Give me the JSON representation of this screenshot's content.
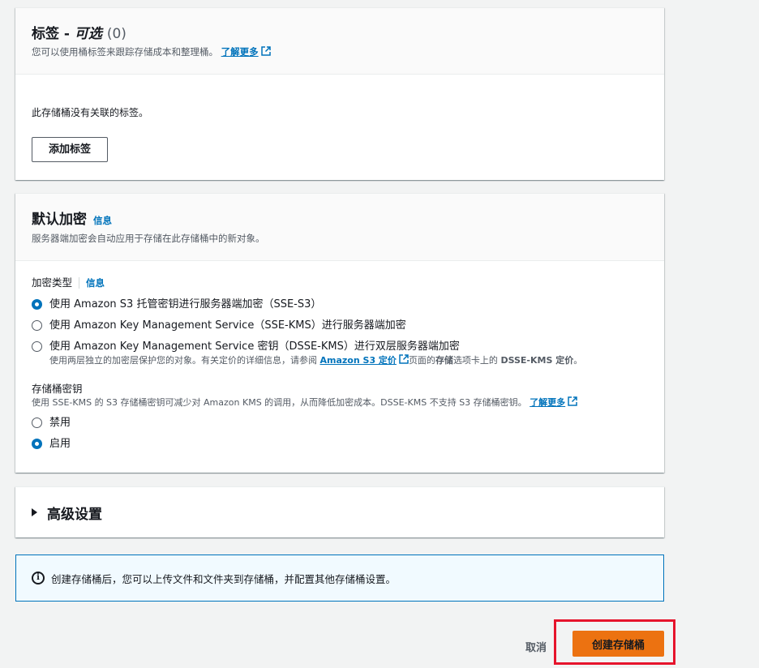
{
  "tags": {
    "title": "标签 - ",
    "title_italic": "可选",
    "count": "(0)",
    "desc": "您可以使用桶标签来跟踪存储成本和整理桶。",
    "learn_more": "了解更多",
    "empty_text": "此存储桶没有关联的标签。",
    "add_button": "添加标签"
  },
  "encryption": {
    "title": "默认加密",
    "info": "信息",
    "desc": "服务器端加密会自动应用于存储在此存储桶中的新对象。",
    "type_label": "加密类型",
    "type_info": "信息",
    "options": [
      {
        "label": "使用 Amazon S3 托管密钥进行服务器端加密（SSE-S3）",
        "selected": true
      },
      {
        "label": "使用 Amazon Key Management Service（SSE-KMS）进行服务器端加密",
        "selected": false
      },
      {
        "label": "使用 Amazon Key Management Service 密钥（DSSE-KMS）进行双层服务器端加密",
        "selected": false
      }
    ],
    "dsse_sub_1": "使用两层独立的加密层保护您的对象。有关定价的详细信息，请参阅 ",
    "dsse_sub_link": "Amazon S3 定价",
    "dsse_sub_2": "页面的",
    "dsse_sub_bold1": "存储",
    "dsse_sub_3": "选项卡上的 ",
    "dsse_sub_bold2": "DSSE-KMS 定价",
    "dsse_sub_4": "。",
    "bucket_key_label": "存储桶密钥",
    "bucket_key_desc": "使用 SSE-KMS 的 S3 存储桶密钥可减少对 Amazon KMS 的调用，从而降低加密成本。DSSE-KMS 不支持 S3 存储桶密钥。",
    "bucket_key_learn_more": "了解更多",
    "bucket_key_options": [
      {
        "label": "禁用",
        "selected": false
      },
      {
        "label": "启用",
        "selected": true
      }
    ]
  },
  "advanced": {
    "title": "高级设置"
  },
  "alert": {
    "icon": "info-circle-icon",
    "text": "创建存储桶后，您可以上传文件和文件夹到存储桶，并配置其他存储桶设置。"
  },
  "footer": {
    "cancel": "取消",
    "create": "创建存储桶"
  },
  "colors": {
    "primary_button": "#ec7211",
    "link": "#0073bb",
    "highlight_box": "#e6142c"
  }
}
